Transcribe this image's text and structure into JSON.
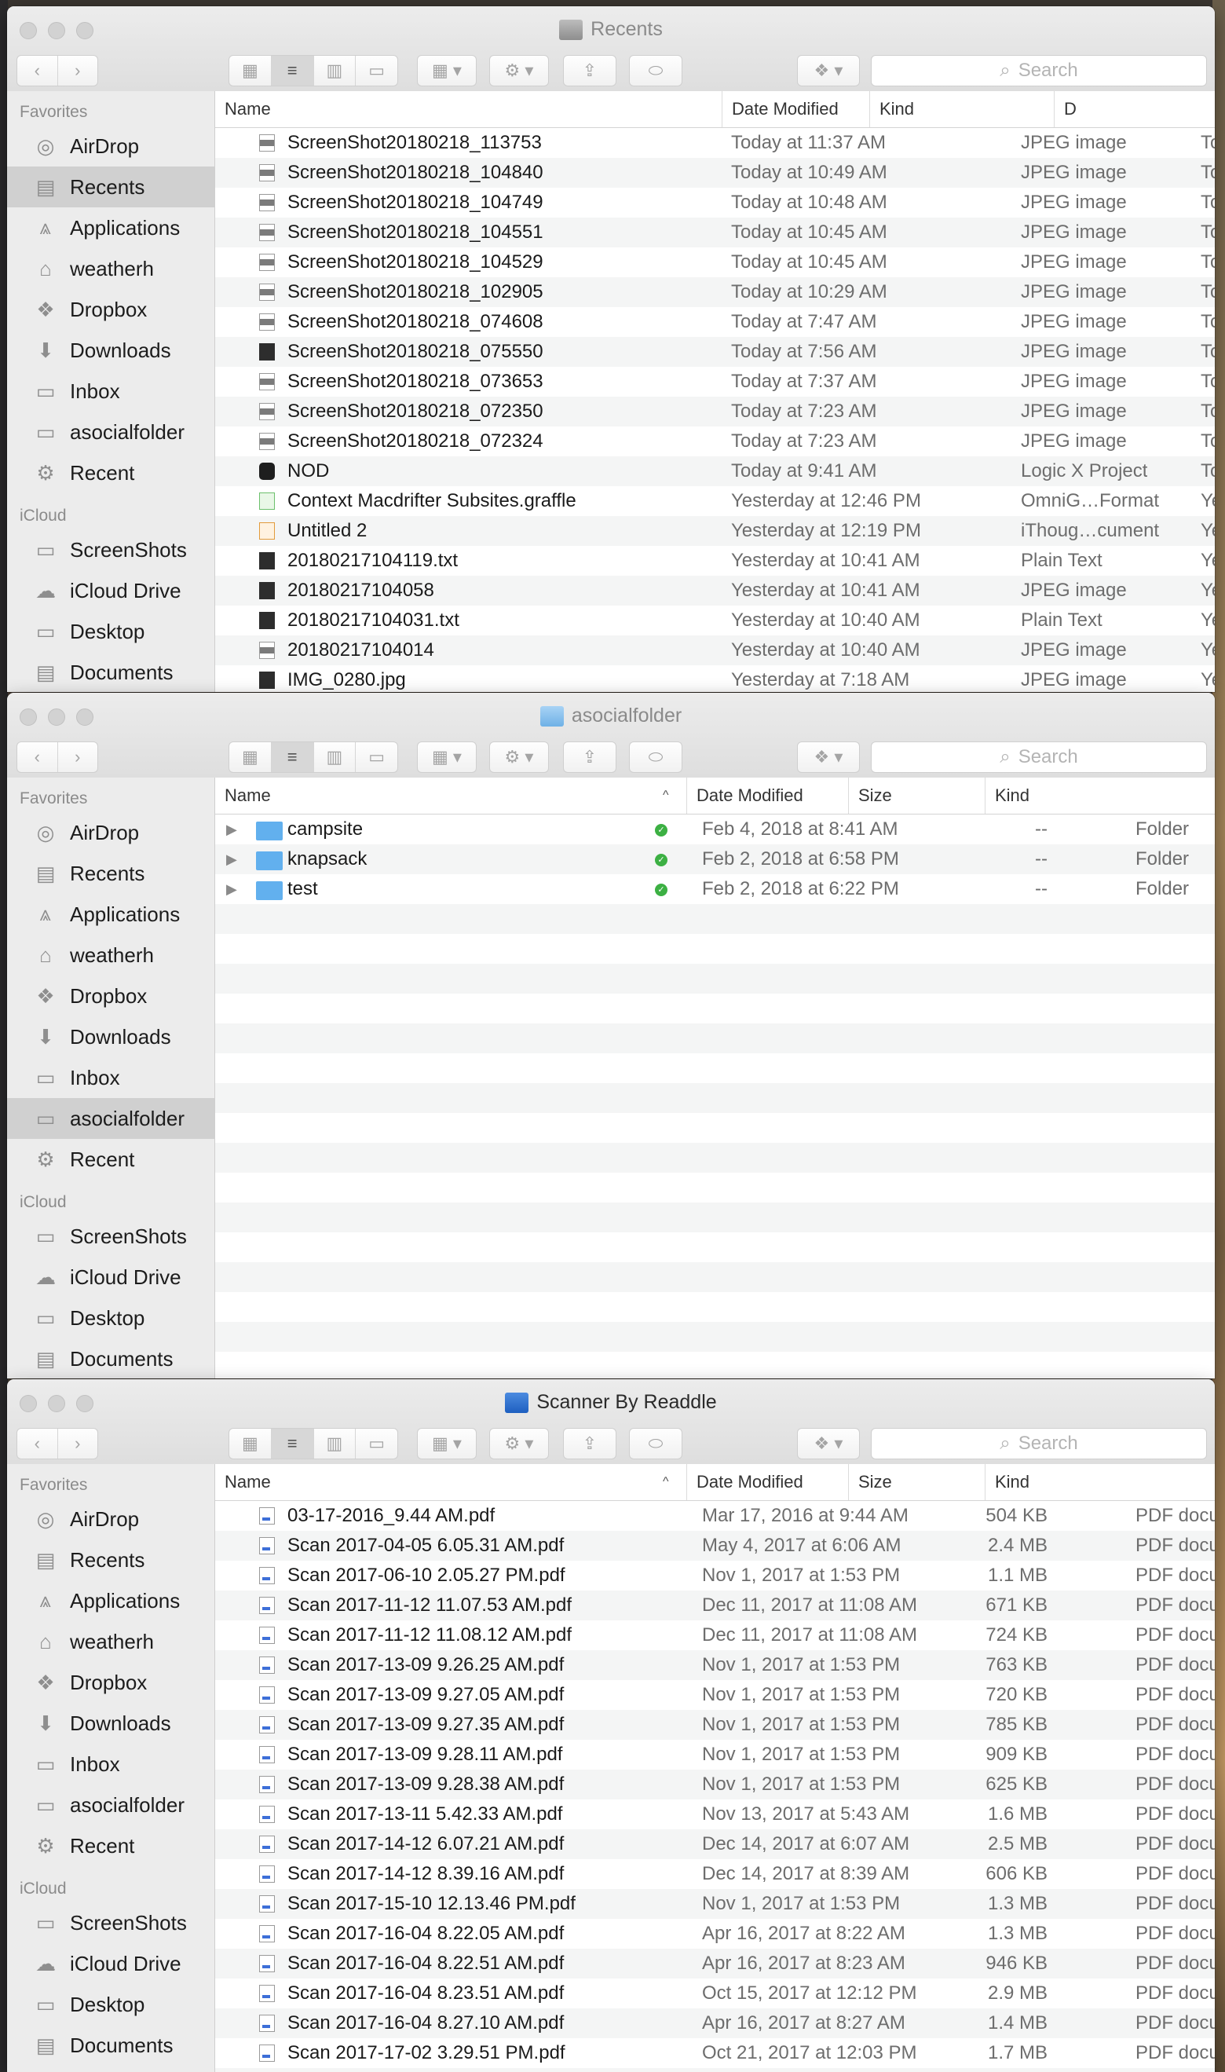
{
  "sidebar": {
    "favorites_header": "Favorites",
    "icloud_header": "iCloud",
    "favorites": [
      {
        "label": "AirDrop",
        "icon": "airdrop-icon",
        "glyph": "◎"
      },
      {
        "label": "Recents",
        "icon": "recents-icon",
        "glyph": "▤"
      },
      {
        "label": "Applications",
        "icon": "applications-icon",
        "glyph": "⩓"
      },
      {
        "label": "weatherh",
        "icon": "home-icon",
        "glyph": "⌂"
      },
      {
        "label": "Dropbox",
        "icon": "dropbox-icon",
        "glyph": "❖"
      },
      {
        "label": "Downloads",
        "icon": "downloads-icon",
        "glyph": "⬇"
      },
      {
        "label": "Inbox",
        "icon": "folder-icon",
        "glyph": "▭"
      },
      {
        "label": "asocialfolder",
        "icon": "folder-icon",
        "glyph": "▭"
      },
      {
        "label": "Recent",
        "icon": "gear-icon",
        "glyph": "⚙"
      }
    ],
    "icloud": [
      {
        "label": "ScreenShots",
        "icon": "folder-icon",
        "glyph": "▭"
      },
      {
        "label": "iCloud Drive",
        "icon": "cloud-icon",
        "glyph": "☁"
      },
      {
        "label": "Desktop",
        "icon": "desktop-icon",
        "glyph": "▭"
      },
      {
        "label": "Documents",
        "icon": "documents-icon",
        "glyph": "▤"
      }
    ]
  },
  "toolbar": {
    "search_placeholder": "Search",
    "search_glyph": "⌕"
  },
  "windows": [
    {
      "title": "Recents",
      "selected_sidebar": "Recents",
      "columns": [
        "Name",
        "Date Modified",
        "Kind",
        "D"
      ],
      "rows": [
        {
          "name": "ScreenShot20180218_113753",
          "date": "Today at 11:37 AM",
          "kind": "JPEG image",
          "extra": "To",
          "icon": "img"
        },
        {
          "name": "ScreenShot20180218_104840",
          "date": "Today at 10:49 AM",
          "kind": "JPEG image",
          "extra": "To",
          "icon": "img"
        },
        {
          "name": "ScreenShot20180218_104749",
          "date": "Today at 10:48 AM",
          "kind": "JPEG image",
          "extra": "To",
          "icon": "img"
        },
        {
          "name": "ScreenShot20180218_104551",
          "date": "Today at 10:45 AM",
          "kind": "JPEG image",
          "extra": "To",
          "icon": "img"
        },
        {
          "name": "ScreenShot20180218_104529",
          "date": "Today at 10:45 AM",
          "kind": "JPEG image",
          "extra": "To",
          "icon": "img"
        },
        {
          "name": "ScreenShot20180218_102905",
          "date": "Today at 10:29 AM",
          "kind": "JPEG image",
          "extra": "To",
          "icon": "img"
        },
        {
          "name": "ScreenShot20180218_074608",
          "date": "Today at 7:47 AM",
          "kind": "JPEG image",
          "extra": "To",
          "icon": "img"
        },
        {
          "name": "ScreenShot20180218_075550",
          "date": "Today at 7:56 AM",
          "kind": "JPEG image",
          "extra": "To",
          "icon": "dark"
        },
        {
          "name": "ScreenShot20180218_073653",
          "date": "Today at 7:37 AM",
          "kind": "JPEG image",
          "extra": "To",
          "icon": "img"
        },
        {
          "name": "ScreenShot20180218_072350",
          "date": "Today at 7:23 AM",
          "kind": "JPEG image",
          "extra": "To",
          "icon": "img"
        },
        {
          "name": "ScreenShot20180218_072324",
          "date": "Today at 7:23 AM",
          "kind": "JPEG image",
          "extra": "To",
          "icon": "img"
        },
        {
          "name": "NOD",
          "date": "Today at 9:41 AM",
          "kind": "Logic X Project",
          "extra": "To",
          "icon": "logic"
        },
        {
          "name": "Context Macdrifter Subsites.graffle",
          "date": "Yesterday at 12:46 PM",
          "kind": "OmniG…Format",
          "extra": "Ye",
          "icon": "omni"
        },
        {
          "name": "Untitled 2",
          "date": "Yesterday at 12:19 PM",
          "kind": "iThoug…cument",
          "extra": "Ye",
          "icon": "ithoughts"
        },
        {
          "name": "20180217104119.txt",
          "date": "Yesterday at 10:41 AM",
          "kind": "Plain Text",
          "extra": "Ye",
          "icon": "dark"
        },
        {
          "name": "20180217104058",
          "date": "Yesterday at 10:41 AM",
          "kind": "JPEG image",
          "extra": "Ye",
          "icon": "dark"
        },
        {
          "name": "20180217104031.txt",
          "date": "Yesterday at 10:40 AM",
          "kind": "Plain Text",
          "extra": "Ye",
          "icon": "dark"
        },
        {
          "name": "20180217104014",
          "date": "Yesterday at 10:40 AM",
          "kind": "JPEG image",
          "extra": "Ye",
          "icon": "img"
        },
        {
          "name": "IMG_0280.jpg",
          "date": "Yesterday at 7:18 AM",
          "kind": "JPEG image",
          "extra": "Ye",
          "icon": "dark"
        }
      ]
    },
    {
      "title": "asocialfolder",
      "selected_sidebar": "asocialfolder",
      "columns": [
        "Name",
        "Date Modified",
        "Size",
        "Kind"
      ],
      "rows": [
        {
          "name": "campsite",
          "date": "Feb 4, 2018 at 8:41 AM",
          "size": "--",
          "kind": "Folder",
          "disclosure": "▶",
          "sync": "✓"
        },
        {
          "name": "knapsack",
          "date": "Feb 2, 2018 at 6:58 PM",
          "size": "--",
          "kind": "Folder",
          "disclosure": "▶",
          "sync": "✓"
        },
        {
          "name": "test",
          "date": "Feb 2, 2018 at 6:22 PM",
          "size": "--",
          "kind": "Folder",
          "disclosure": "▶",
          "sync": "✓"
        }
      ],
      "sort_glyph": "^"
    },
    {
      "title": "Scanner By Readdle",
      "selected_sidebar": "",
      "columns": [
        "Name",
        "Date Modified",
        "Size",
        "Kind"
      ],
      "sort_glyph": "^",
      "rows": [
        {
          "name": "03-17-2016_9.44 AM.pdf",
          "date": "Mar 17, 2016 at 9:44 AM",
          "size": "504 KB",
          "kind": "PDF docu"
        },
        {
          "name": "Scan 2017-04-05 6.05.31 AM.pdf",
          "date": "May 4, 2017 at 6:06 AM",
          "size": "2.4 MB",
          "kind": "PDF docu"
        },
        {
          "name": "Scan 2017-06-10 2.05.27 PM.pdf",
          "date": "Nov 1, 2017 at 1:53 PM",
          "size": "1.1 MB",
          "kind": "PDF docu"
        },
        {
          "name": "Scan 2017-11-12 11.07.53 AM.pdf",
          "date": "Dec 11, 2017 at 11:08 AM",
          "size": "671 KB",
          "kind": "PDF docu"
        },
        {
          "name": "Scan 2017-11-12 11.08.12 AM.pdf",
          "date": "Dec 11, 2017 at 11:08 AM",
          "size": "724 KB",
          "kind": "PDF docu"
        },
        {
          "name": "Scan 2017-13-09 9.26.25 AM.pdf",
          "date": "Nov 1, 2017 at 1:53 PM",
          "size": "763 KB",
          "kind": "PDF docu"
        },
        {
          "name": "Scan 2017-13-09 9.27.05 AM.pdf",
          "date": "Nov 1, 2017 at 1:53 PM",
          "size": "720 KB",
          "kind": "PDF docu"
        },
        {
          "name": "Scan 2017-13-09 9.27.35 AM.pdf",
          "date": "Nov 1, 2017 at 1:53 PM",
          "size": "785 KB",
          "kind": "PDF docu"
        },
        {
          "name": "Scan 2017-13-09 9.28.11 AM.pdf",
          "date": "Nov 1, 2017 at 1:53 PM",
          "size": "909 KB",
          "kind": "PDF docu"
        },
        {
          "name": "Scan 2017-13-09 9.28.38 AM.pdf",
          "date": "Nov 1, 2017 at 1:53 PM",
          "size": "625 KB",
          "kind": "PDF docu"
        },
        {
          "name": "Scan 2017-13-11 5.42.33 AM.pdf",
          "date": "Nov 13, 2017 at 5:43 AM",
          "size": "1.6 MB",
          "kind": "PDF docu"
        },
        {
          "name": "Scan 2017-14-12 6.07.21 AM.pdf",
          "date": "Dec 14, 2017 at 6:07 AM",
          "size": "2.5 MB",
          "kind": "PDF docu"
        },
        {
          "name": "Scan 2017-14-12 8.39.16 AM.pdf",
          "date": "Dec 14, 2017 at 8:39 AM",
          "size": "606 KB",
          "kind": "PDF docu"
        },
        {
          "name": "Scan 2017-15-10 12.13.46 PM.pdf",
          "date": "Nov 1, 2017 at 1:53 PM",
          "size": "1.3 MB",
          "kind": "PDF docu"
        },
        {
          "name": "Scan 2017-16-04 8.22.05 AM.pdf",
          "date": "Apr 16, 2017 at 8:22 AM",
          "size": "1.3 MB",
          "kind": "PDF docu"
        },
        {
          "name": "Scan 2017-16-04 8.22.51 AM.pdf",
          "date": "Apr 16, 2017 at 8:23 AM",
          "size": "946 KB",
          "kind": "PDF docu"
        },
        {
          "name": "Scan 2017-16-04 8.23.51 AM.pdf",
          "date": "Oct 15, 2017 at 12:12 PM",
          "size": "2.9 MB",
          "kind": "PDF docu"
        },
        {
          "name": "Scan 2017-16-04 8.27.10 AM.pdf",
          "date": "Apr 16, 2017 at 8:27 AM",
          "size": "1.4 MB",
          "kind": "PDF docu"
        },
        {
          "name": "Scan 2017-17-02 3.29.51 PM.pdf",
          "date": "Oct 21, 2017 at 12:03 PM",
          "size": "1.7 MB",
          "kind": "PDF docu"
        }
      ]
    }
  ]
}
